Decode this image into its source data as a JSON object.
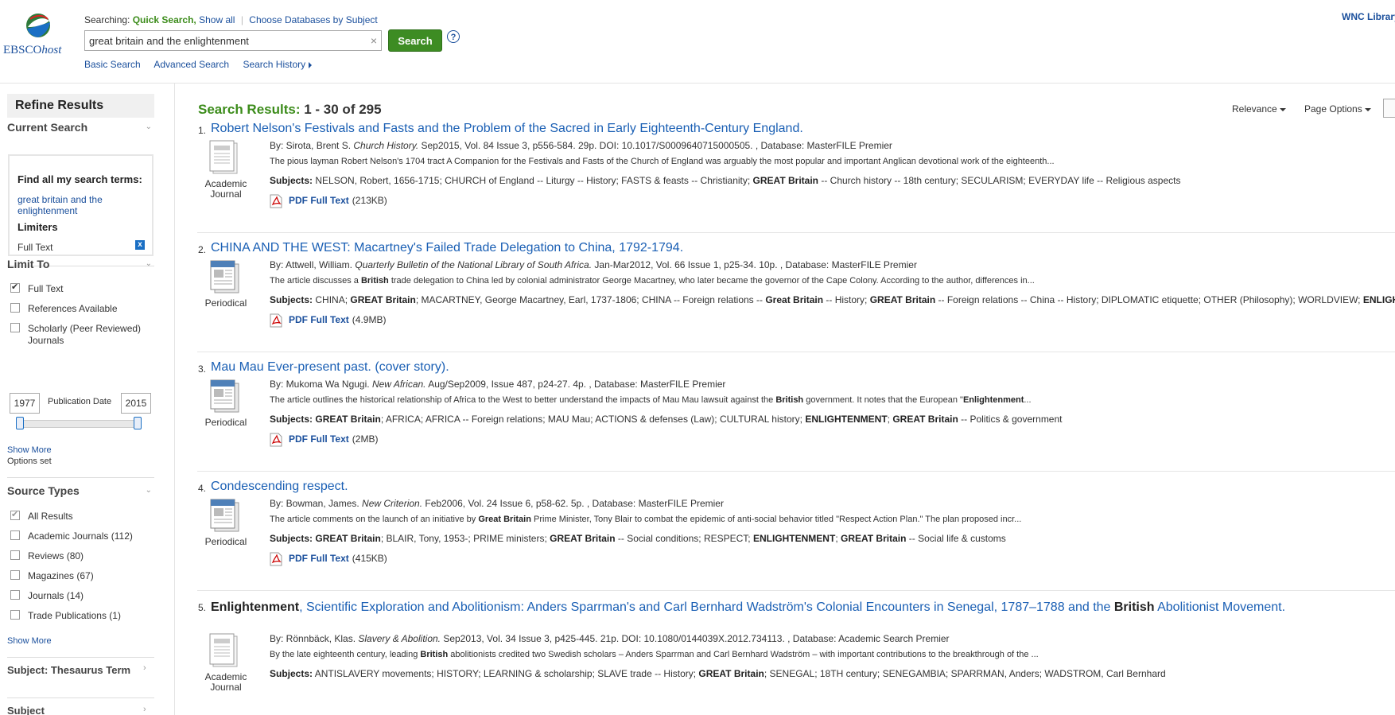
{
  "header": {
    "logo_main": "EBSCO",
    "logo_host": "host",
    "searching_label": "Searching:",
    "searching_db": "Quick Search,",
    "show_all": "Show all",
    "choose_db": "Choose Databases by Subject",
    "query": "great britain and the enlightenment",
    "clear": "×",
    "search_button": "Search",
    "help": "?",
    "basic_search": "Basic Search",
    "advanced_search": "Advanced Search",
    "search_history": "Search History",
    "org": "WNC Library"
  },
  "sidebar": {
    "refine_title": "Refine Results",
    "current_search": {
      "heading": "Current Search",
      "find_all": "Find all my search terms:",
      "terms": "great britain and the enlightenment",
      "limiters": "Limiters",
      "full_text": "Full Text",
      "remove": "x"
    },
    "limit_to": {
      "heading": "Limit To",
      "items": [
        {
          "label": "Full Text",
          "checked": true
        },
        {
          "label": "References Available",
          "checked": false
        },
        {
          "label": "Scholarly (Peer Reviewed)",
          "label2": "Journals",
          "checked": false
        }
      ],
      "date_from": "1977",
      "date_to": "2015",
      "date_label": "Publication Date",
      "show_more": "Show More",
      "options_set": "Options set"
    },
    "source_types": {
      "heading": "Source Types",
      "items": [
        {
          "label": "All Results",
          "count": "",
          "checked": true
        },
        {
          "label": "Academic Journals",
          "count": "(112)",
          "checked": false
        },
        {
          "label": "Reviews",
          "count": "(80)",
          "checked": false
        },
        {
          "label": "Magazines",
          "count": "(67)",
          "checked": false
        },
        {
          "label": "Journals",
          "count": "(14)",
          "checked": false
        },
        {
          "label": "Trade Publications",
          "count": "(1)",
          "checked": false
        }
      ],
      "show_more": "Show More"
    },
    "subject_thesaurus": "Subject: Thesaurus Term",
    "subject": "Subject"
  },
  "results": {
    "label": "Search Results:",
    "range": "1 - 30 of 295",
    "sort": "Relevance",
    "page_options": "Page Options",
    "pdf_label": "PDF Full Text",
    "subjects_label": "Subjects:",
    "records": [
      {
        "num": "1.",
        "title": "Robert Nelson's Festivals and Fasts and the Problem of the Sacred in Early Eighteenth-Century England.",
        "type": "Academic Journal",
        "by": "By: Sirota, Brent S. ",
        "source": "Church History.",
        "meta_rest": " Sep2015, Vol. 84 Issue 3, p556-584. 29p. DOI: 10.1017/S0009640715000505. , Database: MasterFILE Premier",
        "abstract": "The pious layman Robert Nelson's 1704 tract A Companion for the Festivals and Fasts of the Church of England was arguably the most popular and important Anglican devotional work of the eighteenth...",
        "subjects": [
          {
            "t": "NELSON, Robert, 1656-1715; CHURCH of England -- Liturgy -- History; FASTS & feasts -- Christianity; ",
            "b": false
          },
          {
            "t": "GREAT Britain",
            "b": true
          },
          {
            "t": " -- Church history -- 18th century; SECULARISM; EVERYDAY life -- Religious aspects",
            "b": false
          }
        ],
        "pdf_size": "(213KB)"
      },
      {
        "num": "2.",
        "title": "CHINA AND THE WEST: Macartney's Failed Trade Delegation to China, 1792-1794.",
        "type": "Periodical",
        "by": "By: Attwell, William. ",
        "source": "Quarterly Bulletin of the National Library of South Africa.",
        "meta_rest": " Jan-Mar2012, Vol. 66 Issue 1, p25-34. 10p. , Database: MasterFILE Premier",
        "abstract_parts": [
          {
            "t": "The article discusses a ",
            "b": false
          },
          {
            "t": "British",
            "b": true
          },
          {
            "t": " trade delegation to China led by colonial administrator George Macartney, who later became the governor of the Cape Colony. According to the author, differences in...",
            "b": false
          }
        ],
        "subjects": [
          {
            "t": "CHINA; ",
            "b": false
          },
          {
            "t": "GREAT Britain",
            "b": true
          },
          {
            "t": "; MACARTNEY, George Macartney, Earl, 1737-1806; CHINA -- Foreign relations -- ",
            "b": false
          },
          {
            "t": "Great Britain",
            "b": true
          },
          {
            "t": " -- History; ",
            "b": false
          },
          {
            "t": "GREAT Britain",
            "b": true
          },
          {
            "t": " -- Foreign relations -- China -- History; DIPLOMATIC etiquette; OTHER (Philosophy); WORLDVIEW; ",
            "b": false
          },
          {
            "t": "ENLIGHTENMENT",
            "b": true
          }
        ],
        "pdf_size": "(4.9MB)"
      },
      {
        "num": "3.",
        "title": "Mau Mau Ever-present past. (cover story).",
        "type": "Periodical",
        "by": "By: Mukoma Wa Ngugi. ",
        "source": "New African.",
        "meta_rest": " Aug/Sep2009, Issue 487, p24-27. 4p. , Database: MasterFILE Premier",
        "abstract_parts": [
          {
            "t": "The article outlines the historical relationship of Africa to the West to better understand the impacts of Mau Mau lawsuit against the ",
            "b": false
          },
          {
            "t": "British",
            "b": true
          },
          {
            "t": " government. It notes that the European \"",
            "b": false
          },
          {
            "t": "Enlightenment",
            "b": true
          },
          {
            "t": "...",
            "b": false
          }
        ],
        "subjects": [
          {
            "t": "GREAT Britain",
            "b": true
          },
          {
            "t": "; AFRICA; AFRICA -- Foreign relations; MAU Mau; ACTIONS & defenses (Law); CULTURAL history; ",
            "b": false
          },
          {
            "t": "ENLIGHTENMENT",
            "b": true
          },
          {
            "t": "; ",
            "b": false
          },
          {
            "t": "GREAT Britain",
            "b": true
          },
          {
            "t": " -- Politics & government",
            "b": false
          }
        ],
        "pdf_size": "(2MB)"
      },
      {
        "num": "4.",
        "title": "Condescending respect.",
        "type": "Periodical",
        "by": "By: Bowman, James. ",
        "source": "New Criterion.",
        "meta_rest": " Feb2006, Vol. 24 Issue 6, p58-62. 5p. , Database: MasterFILE Premier",
        "abstract_parts": [
          {
            "t": "The article comments on the launch of an initiative by ",
            "b": false
          },
          {
            "t": "Great Britain",
            "b": true
          },
          {
            "t": " Prime Minister, Tony Blair to combat the epidemic of anti-social behavior titled \"Respect Action Plan.\" The plan proposed incr...",
            "b": false
          }
        ],
        "subjects": [
          {
            "t": "GREAT Britain",
            "b": true
          },
          {
            "t": "; BLAIR, Tony, 1953-; PRIME ministers; ",
            "b": false
          },
          {
            "t": "GREAT Britain",
            "b": true
          },
          {
            "t": " -- Social conditions; RESPECT; ",
            "b": false
          },
          {
            "t": "ENLIGHTENMENT",
            "b": true
          },
          {
            "t": "; ",
            "b": false
          },
          {
            "t": "GREAT Britain",
            "b": true
          },
          {
            "t": " -- Social life & customs",
            "b": false
          }
        ],
        "pdf_size": "(415KB)"
      },
      {
        "num": "5.",
        "title_parts": [
          {
            "t": "Enlightenment",
            "b": true
          },
          {
            "t": ", Scientific Exploration and Abolitionism: Anders Sparrman's and Carl Bernhard Wadström's Colonial Encounters in Senegal, 1787–1788 and the ",
            "b": false
          },
          {
            "t": "British",
            "b": true
          },
          {
            "t": " Abolitionist Movement.",
            "b": false
          }
        ],
        "type": "Academic Journal",
        "by": "By: Rönnbäck, Klas. ",
        "source": "Slavery & Abolition.",
        "meta_rest": " Sep2013, Vol. 34 Issue 3, p425-445. 21p. DOI: 10.1080/0144039X.2012.734113. , Database: Academic Search Premier",
        "abstract_parts": [
          {
            "t": "By the late eighteenth century, leading ",
            "b": false
          },
          {
            "t": "British",
            "b": true
          },
          {
            "t": " abolitionists credited two Swedish scholars – Anders Sparrman and Carl Bernhard Wadström – with important contributions to the breakthrough of the ...",
            "b": false
          }
        ],
        "subjects": [
          {
            "t": "ANTISLAVERY movements; HISTORY; LEARNING & scholarship; SLAVE trade -- History; ",
            "b": false
          },
          {
            "t": "GREAT Britain",
            "b": true
          },
          {
            "t": "; SENEGAL; 18TH century; SENEGAMBIA; SPARRMAN, Anders; WADSTROM, Carl Bernhard",
            "b": false
          }
        ]
      }
    ]
  }
}
